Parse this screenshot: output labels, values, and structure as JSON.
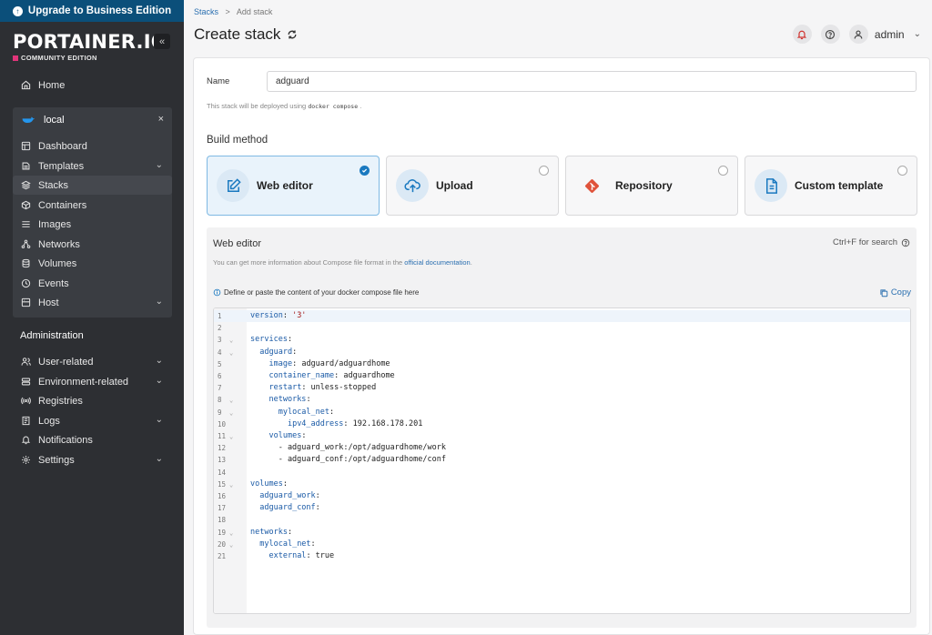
{
  "sidebar": {
    "upgrade_label": "Upgrade to Business Edition",
    "logo": "PORTAINER.IO",
    "edition": "COMMUNITY EDITION",
    "collapse_glyph": "«",
    "home_label": "Home",
    "environment": {
      "name": "local",
      "close_glyph": "×",
      "items": [
        {
          "label": "Dashboard",
          "icon": "dashboard-icon",
          "chevron": ""
        },
        {
          "label": "Templates",
          "icon": "templates-icon",
          "chevron": "⌄"
        },
        {
          "label": "Stacks",
          "icon": "stacks-icon",
          "chevron": ""
        },
        {
          "label": "Containers",
          "icon": "containers-icon",
          "chevron": ""
        },
        {
          "label": "Images",
          "icon": "images-icon",
          "chevron": ""
        },
        {
          "label": "Networks",
          "icon": "networks-icon",
          "chevron": ""
        },
        {
          "label": "Volumes",
          "icon": "volumes-icon",
          "chevron": ""
        },
        {
          "label": "Events",
          "icon": "events-icon",
          "chevron": ""
        },
        {
          "label": "Host",
          "icon": "host-icon",
          "chevron": "⌄"
        }
      ]
    },
    "admin_title": "Administration",
    "admin_items": [
      {
        "label": "User-related",
        "chevron": "⌄"
      },
      {
        "label": "Environment-related",
        "chevron": "⌄"
      },
      {
        "label": "Registries",
        "chevron": ""
      },
      {
        "label": "Logs",
        "chevron": "⌄"
      },
      {
        "label": "Notifications",
        "chevron": ""
      },
      {
        "label": "Settings",
        "chevron": "⌄"
      }
    ]
  },
  "header": {
    "breadcrumb_link": "Stacks",
    "breadcrumb_sep": ">",
    "breadcrumb_current": "Add stack",
    "title": "Create stack",
    "user": "admin"
  },
  "form": {
    "name_label": "Name",
    "name_value": "adguard",
    "deploy_note_prefix": "This stack will be deployed using",
    "deploy_note_code": "docker compose",
    "deploy_note_suffix": ".",
    "build_method_title": "Build method",
    "methods": [
      {
        "label": "Web editor",
        "selected": true
      },
      {
        "label": "Upload",
        "selected": false
      },
      {
        "label": "Repository",
        "selected": false
      },
      {
        "label": "Custom template",
        "selected": false
      }
    ]
  },
  "editor": {
    "title": "Web editor",
    "search_hint": "Ctrl+F for search",
    "info_prefix": "You can get more information about Compose file format in the",
    "info_link": "official documentation",
    "info_suffix": ".",
    "hint": "Define or paste the content of your docker compose file here",
    "copy_label": "Copy",
    "lines": [
      {
        "n": "1",
        "fold": false,
        "code": "version: '3'"
      },
      {
        "n": "2",
        "fold": false,
        "code": ""
      },
      {
        "n": "3",
        "fold": true,
        "code": "services:"
      },
      {
        "n": "4",
        "fold": true,
        "code": "  adguard:"
      },
      {
        "n": "5",
        "fold": false,
        "code": "    image: adguard/adguardhome"
      },
      {
        "n": "6",
        "fold": false,
        "code": "    container_name: adguardhome"
      },
      {
        "n": "7",
        "fold": false,
        "code": "    restart: unless-stopped"
      },
      {
        "n": "8",
        "fold": true,
        "code": "    networks:"
      },
      {
        "n": "9",
        "fold": true,
        "code": "      mylocal_net:"
      },
      {
        "n": "10",
        "fold": false,
        "code": "        ipv4_address: 192.168.178.201"
      },
      {
        "n": "11",
        "fold": true,
        "code": "    volumes:"
      },
      {
        "n": "12",
        "fold": false,
        "code": "      - adguard_work:/opt/adguardhome/work"
      },
      {
        "n": "13",
        "fold": false,
        "code": "      - adguard_conf:/opt/adguardhome/conf"
      },
      {
        "n": "14",
        "fold": false,
        "code": ""
      },
      {
        "n": "15",
        "fold": true,
        "code": "volumes:"
      },
      {
        "n": "16",
        "fold": false,
        "code": "  adguard_work:"
      },
      {
        "n": "17",
        "fold": false,
        "code": "  adguard_conf:"
      },
      {
        "n": "18",
        "fold": false,
        "code": ""
      },
      {
        "n": "19",
        "fold": true,
        "code": "networks:"
      },
      {
        "n": "20",
        "fold": true,
        "code": "  mylocal_net:"
      },
      {
        "n": "21",
        "fold": false,
        "code": "    external: true"
      }
    ]
  },
  "colors": {
    "sidebar_bg": "#2d2f33",
    "upgrade_bg": "#0b4f7a",
    "accent": "#1a79c0",
    "git_orange": "#e0533b"
  }
}
